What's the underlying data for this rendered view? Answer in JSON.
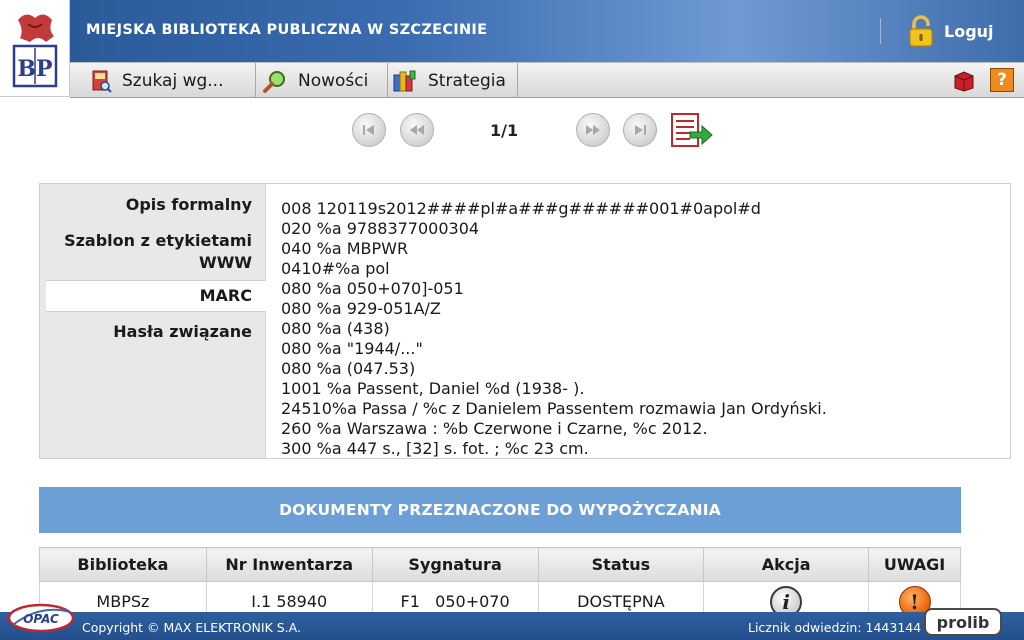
{
  "header": {
    "logo_text": "BP",
    "title": "MIEJSKA BIBLIOTEKA PUBLICZNA W SZCZECINIE",
    "login_label": "Loguj"
  },
  "nav": {
    "items": [
      {
        "label": "Szukaj wg...",
        "icon": "search-book-icon"
      },
      {
        "label": "Nowości",
        "icon": "magnifier-icon"
      },
      {
        "label": "Strategia",
        "icon": "books-icon"
      }
    ],
    "right_icons": [
      "basket-icon",
      "help-icon"
    ],
    "help_glyph": "?"
  },
  "pager": {
    "page": "1/1",
    "buttons": [
      "first-page",
      "previous-page",
      "next-page",
      "last-page",
      "export-record"
    ]
  },
  "record": {
    "tabs": [
      {
        "label": "Opis formalny",
        "active": false
      },
      {
        "label": "Szablon z etykietami WWW",
        "active": false
      },
      {
        "label": "MARC",
        "active": true
      },
      {
        "label": "Hasła związane",
        "active": false
      }
    ],
    "marc_lines": [
      "008 120119s2012####pl#a###g######001#0apol#d",
      "020 %a 9788377000304",
      "040 %a MBPWR",
      "0410#%a pol",
      "080 %a 050+070]-051",
      "080 %a 929-051A/Z",
      "080 %a (438)",
      "080 %a \"1944/...\"",
      "080 %a (047.53)",
      "1001 %a Passent, Daniel %d (1938- ).",
      "24510%a Passa / %c z Danielem Passentem rozmawia Jan Ordyński.",
      "260 %a Warszawa : %b Czerwone i Czarne, %c 2012.",
      "300 %a 447 s., [32] s. fot. ; %c 23 cm."
    ]
  },
  "documents": {
    "banner": "DOKUMENTY PRZEZNACZONE DO WYPOŻYCZANIA",
    "columns": [
      "Biblioteka",
      "Nr Inwentarza",
      "Sygnatura",
      "Status",
      "Akcja",
      "UWAGI"
    ],
    "rows": [
      {
        "biblioteka": "MBPSz",
        "nr_inwentarza": "I.1 58940",
        "sygnatura": "F1   050+070",
        "status": "DOSTĘPNA",
        "akcja_glyph": "i",
        "uwagi_glyph": "!"
      }
    ]
  },
  "footer": {
    "copyright": "Copyright © MAX ELEKTRONIK S.A.",
    "counter": "Licznik odwiedzin: 1443144",
    "opac_logo": "OPAC",
    "prolib_logo": "prolib"
  },
  "colors": {
    "header_blue": "#3b6cb0",
    "banner_blue": "#6b9fd6",
    "footer_blue": "#2f5fa0",
    "warn_orange": "#f06a10"
  }
}
